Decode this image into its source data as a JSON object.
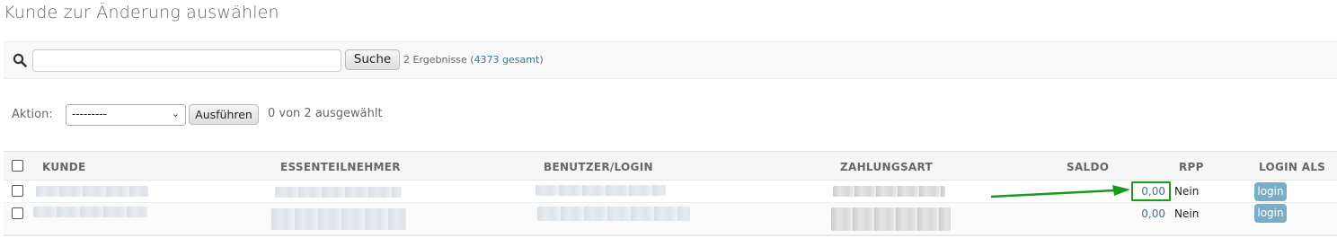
{
  "page": {
    "title": "Kunde zur Änderung auswählen"
  },
  "search": {
    "value": "",
    "placeholder": "",
    "button_label": "Suche",
    "result_prefix": "2 Ergebnisse (",
    "result_total_link": "4373 gesamt",
    "result_suffix": ")"
  },
  "actions": {
    "label": "Aktion:",
    "selected_option": "---------",
    "run_label": "Ausführen",
    "selected_count": "0 von 2 ausgewählt"
  },
  "table": {
    "columns": [
      "KUNDE",
      "ESSENTEILNEHMER",
      "BENUTZER/LOGIN",
      "ZAHLUNGSART",
      "SALDO",
      "RPP",
      "LOGIN ALS"
    ],
    "rows": [
      {
        "saldo": "0,00",
        "rpp": "Nein",
        "login_label": "login"
      },
      {
        "saldo": "0,00",
        "rpp": "Nein",
        "login_label": "login"
      }
    ]
  },
  "colors": {
    "link": "#417690",
    "login_button": "#79aec8",
    "annotation_green": "#1a9a1a"
  },
  "icons": [
    "search-icon",
    "chevron-down-icon",
    "arrow-annotation-icon"
  ]
}
